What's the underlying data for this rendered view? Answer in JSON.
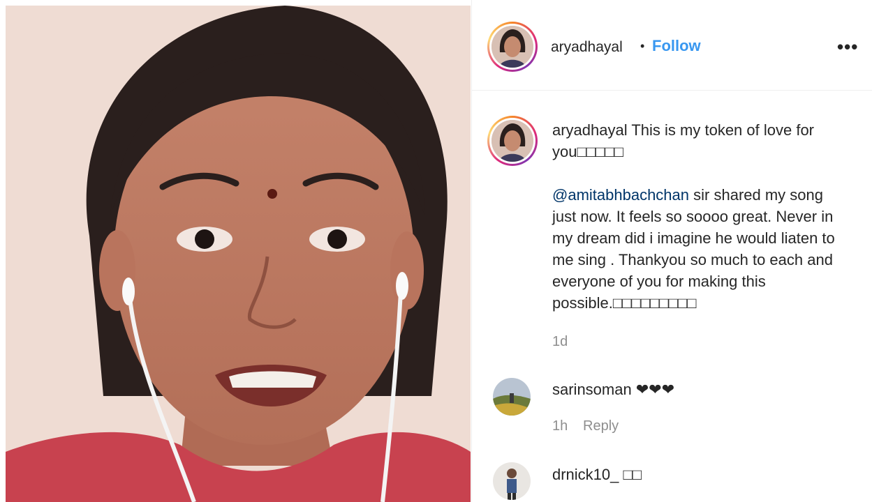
{
  "post": {
    "username": "aryadhayal",
    "follow_separator": "•",
    "follow_label": "Follow",
    "more_label": "•••",
    "caption": {
      "username": "aryadhayal",
      "line1": "This is my token of love for you□□□□□",
      "mention": "@amitabhbachchan",
      "line2": "sir shared my song just now. It feels so soooo great. Never in my dream did i imagine he would liaten to me sing . Thankyou so much to each and everyone of you for making this possible.□□□□□□□□□",
      "time": "1d"
    }
  },
  "comments": [
    {
      "username": "sarinsoman",
      "text": "❤❤❤",
      "time": "1h",
      "reply_label": "Reply"
    },
    {
      "username": "drnick10_",
      "text": "□□"
    }
  ],
  "colors": {
    "link": "#3897f0",
    "mention": "#003569",
    "muted": "#8e8e8e"
  }
}
